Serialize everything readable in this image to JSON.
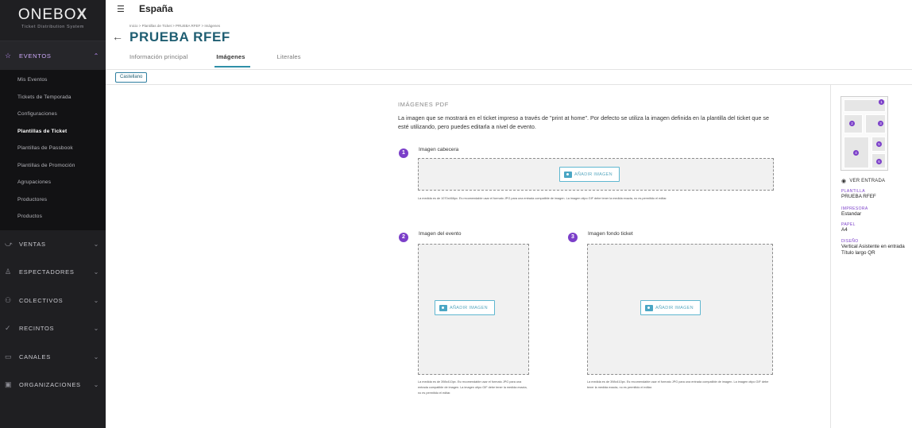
{
  "sidebar": {
    "logo": "ONEBO",
    "logo_x": "X",
    "logo_sub": "Ticket Distribution System",
    "active_section": {
      "label": "EVENTOS",
      "icon": "star-icon"
    },
    "sub_items": [
      {
        "label": "Mis Eventos"
      },
      {
        "label": "Tickets de Temporada"
      },
      {
        "label": "Configuraciones"
      },
      {
        "label": "Plantillas de Ticket"
      },
      {
        "label": "Plantillas de Passbook"
      },
      {
        "label": "Plantillas de Promoción"
      },
      {
        "label": "Agrupaciones"
      },
      {
        "label": "Productores"
      },
      {
        "label": "Productos"
      }
    ],
    "sections": [
      {
        "label": "VENTAS",
        "icon": "sales-icon"
      },
      {
        "label": "ESPECTADORES",
        "icon": "user-icon"
      },
      {
        "label": "COLECTIVOS",
        "icon": "group-icon"
      },
      {
        "label": "RECINTOS",
        "icon": "venue-icon"
      },
      {
        "label": "CANALES",
        "icon": "monitor-icon"
      },
      {
        "label": "ORGANIZACIONES",
        "icon": "building-icon"
      }
    ]
  },
  "header": {
    "country": "España",
    "breadcrumb": "Inicio > Plantillas de Ticket > PRUEBA RFEF > Imágenes",
    "title": "PRUEBA RFEF",
    "tabs": [
      {
        "label": "Información principal"
      },
      {
        "label": "Imágenes"
      },
      {
        "label": "Literales"
      }
    ]
  },
  "language": {
    "label": "Castellano"
  },
  "main": {
    "section_title": "IMÁGENES PDF",
    "description": "La imagen que se mostrará en el ticket impreso a través de \"print at home\". Por defecto se utiliza la imagen definida en la plantilla del ticket que se esté utilizando, pero puedes editarla a nivel de evento.",
    "slots": [
      {
        "number": "1",
        "label": "Imagen cabecera",
        "button": "AÑADIR IMAGEN",
        "note": "La medida es de 1070x466px. Es recomendable usar el formato JPG para una entrada compatible de imagen. La imagen otipo GIF debe tener la medida exacta, no es permitido el editar."
      },
      {
        "number": "2",
        "label": "Imagen del evento",
        "button": "AÑADIR IMAGEN",
        "note": "La medida es de 398x410px. Es recomendable usar el formato JPG para una entrada compatible de imagen. La imagen otipo GIF debe tener la medida exacta, no es permitido el editar."
      },
      {
        "number": "3",
        "label": "Imagen fondo ticket",
        "button": "AÑADIR IMAGEN",
        "note": "La medida es de 398x410px. Es recomendable usar el formato JPG para una entrada compatible de imagen. La imagen otipo GIF debe tener la medida exacta, no es permitido el editar."
      }
    ]
  },
  "right_panel": {
    "thumb_numbers": [
      "1",
      "2",
      "3",
      "4",
      "5",
      "6"
    ],
    "view_ticket": "VER ENTRADA",
    "meta": [
      {
        "key": "PLANTILLA",
        "value": "PRUEBA RFEF"
      },
      {
        "key": "IMPRESORA",
        "value": "Estandar"
      },
      {
        "key": "PAPEL",
        "value": "A4"
      },
      {
        "key": "DISEÑO",
        "value": "Vertical Asistente en entrada Título largo QR"
      }
    ]
  },
  "colors": {
    "sidebar_bg": "#1f1f22",
    "accent_purple": "#7b3fc9",
    "title_teal": "#1f5e72",
    "tab_underline": "#2f90a8"
  }
}
